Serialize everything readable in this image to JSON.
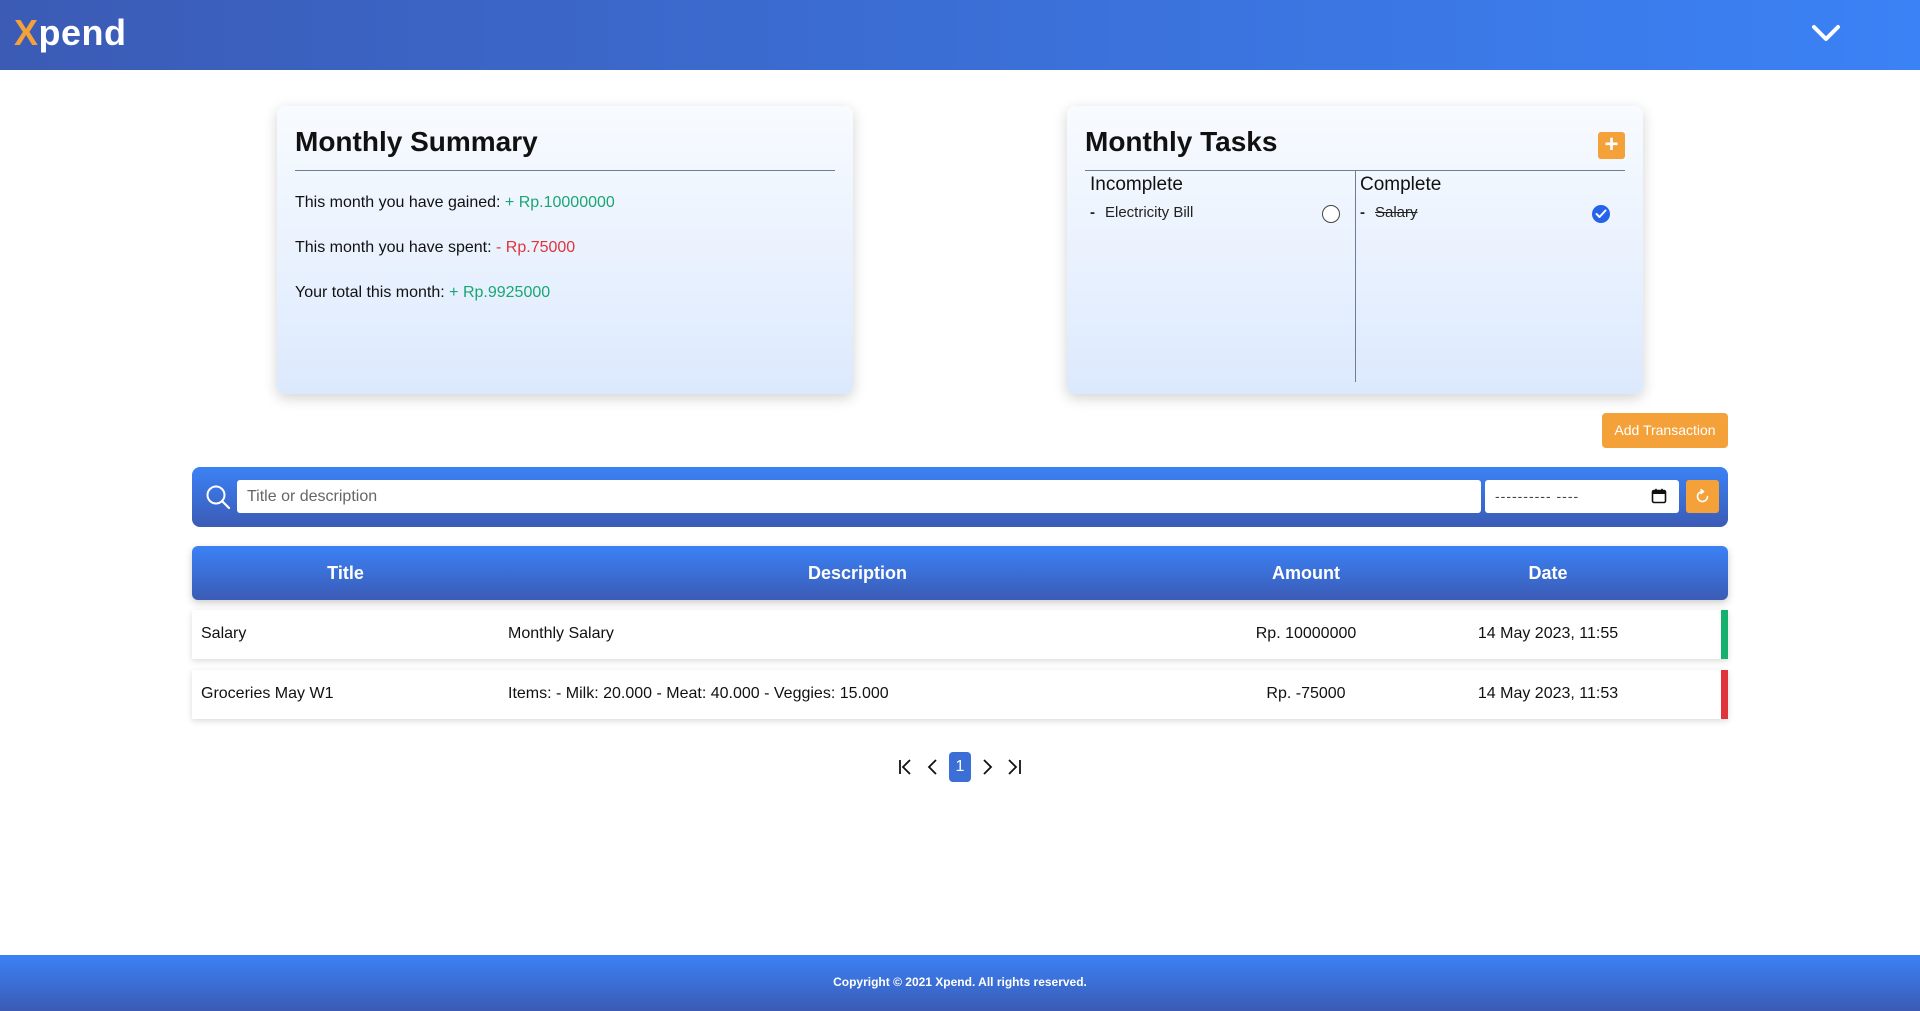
{
  "app": {
    "logo_x": "X",
    "logo_rest": "pend"
  },
  "summary": {
    "title": "Monthly Summary",
    "gained_label": "This month you have gained:",
    "gained_value": "+ Rp.10000000",
    "spent_label": "This month you have spent:",
    "spent_value": "- Rp.75000",
    "total_label": "Your total this month:",
    "total_value": "+ Rp.9925000"
  },
  "tasks": {
    "title": "Monthly Tasks",
    "add_label": "+",
    "incomplete_heading": "Incomplete",
    "complete_heading": "Complete",
    "incomplete_items": [
      {
        "label": "Electricity Bill"
      }
    ],
    "complete_items": [
      {
        "label": "Salary"
      }
    ]
  },
  "actions": {
    "add_transaction_label": "Add Transaction"
  },
  "search": {
    "placeholder": "Title or description",
    "date_placeholder": "---------- ----"
  },
  "table": {
    "headers": [
      "Title",
      "Description",
      "Amount",
      "Date"
    ],
    "rows": [
      {
        "title": "Salary",
        "description": "Monthly Salary",
        "amount": "Rp. 10000000",
        "date": "14 May 2023, 11:55",
        "status_color": "#16b06e"
      },
      {
        "title": "Groceries May W1",
        "description": "Items: - Milk: 20.000 - Meat: 40.000 - Veggies: 15.000",
        "amount": "Rp. -75000",
        "date": "14 May 2023, 11:53",
        "status_color": "#e0343a"
      }
    ]
  },
  "pagination": {
    "current_page": "1"
  },
  "footer": {
    "text": "Copyright © 2021 Xpend. All rights reserved."
  },
  "colors": {
    "accent": "#f4a13a",
    "primary_dark": "#3b5bb5",
    "primary_light": "#3b82f6",
    "positive": "#1aa673",
    "negative": "#e0343a"
  },
  "icons": {
    "header_menu": "chevron-down-icon",
    "search": "search-icon",
    "calendar": "calendar-icon",
    "reset": "refresh-icon",
    "task_done": "check-circle-icon",
    "task_todo": "empty-circle-icon",
    "first_page": "first-page-icon",
    "prev_page": "chevron-left-icon",
    "next_page": "chevron-right-icon",
    "last_page": "last-page-icon"
  }
}
